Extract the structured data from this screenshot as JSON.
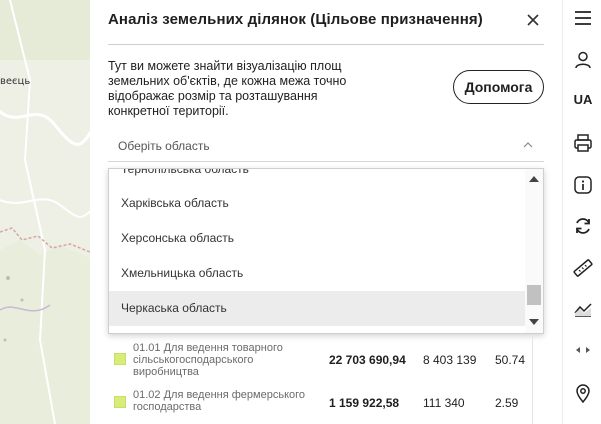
{
  "map": {
    "place_label": "веєць"
  },
  "panel": {
    "title": "Аналіз земельних ділянок (Цільове призначення)",
    "description": "Тут ви можете знайти візуалізацію площ земельних об'єктів, де кожна межа точно відображає розмір та розташування конкретної території.",
    "help_button": "Допомога",
    "region_select": {
      "placeholder": "Оберіть область",
      "options": [
        "Тернопільська область",
        "Харківська область",
        "Херсонська область",
        "Хмельницька область",
        "Черкаська область"
      ],
      "highlighted_option": "Черкаська область"
    },
    "table": {
      "rows": [
        {
          "label": "01.01 Для ведення товарного сільськогосподарського виробництва",
          "area": "22 703 690,94",
          "count": "8 403 139",
          "percent": "50.74"
        },
        {
          "label": "01.02 Для ведення фермерського господарства",
          "area": "1 159 922,58",
          "count": "111 340",
          "percent": "2.59"
        }
      ]
    }
  },
  "toolbar": {
    "language": "UA"
  },
  "colors": {
    "category_swatch": "#d8ec7a",
    "selected_option_bg": "#ececec",
    "map_background": "#eef0e6",
    "border_line": "#d9a4a0"
  },
  "icons": [
    "close-icon",
    "chevron-up-icon",
    "menu-icon",
    "user-icon",
    "print-icon",
    "info-icon",
    "refresh-icon",
    "ruler-icon",
    "chart-icon",
    "expand-arrows-icon",
    "location-icon"
  ]
}
